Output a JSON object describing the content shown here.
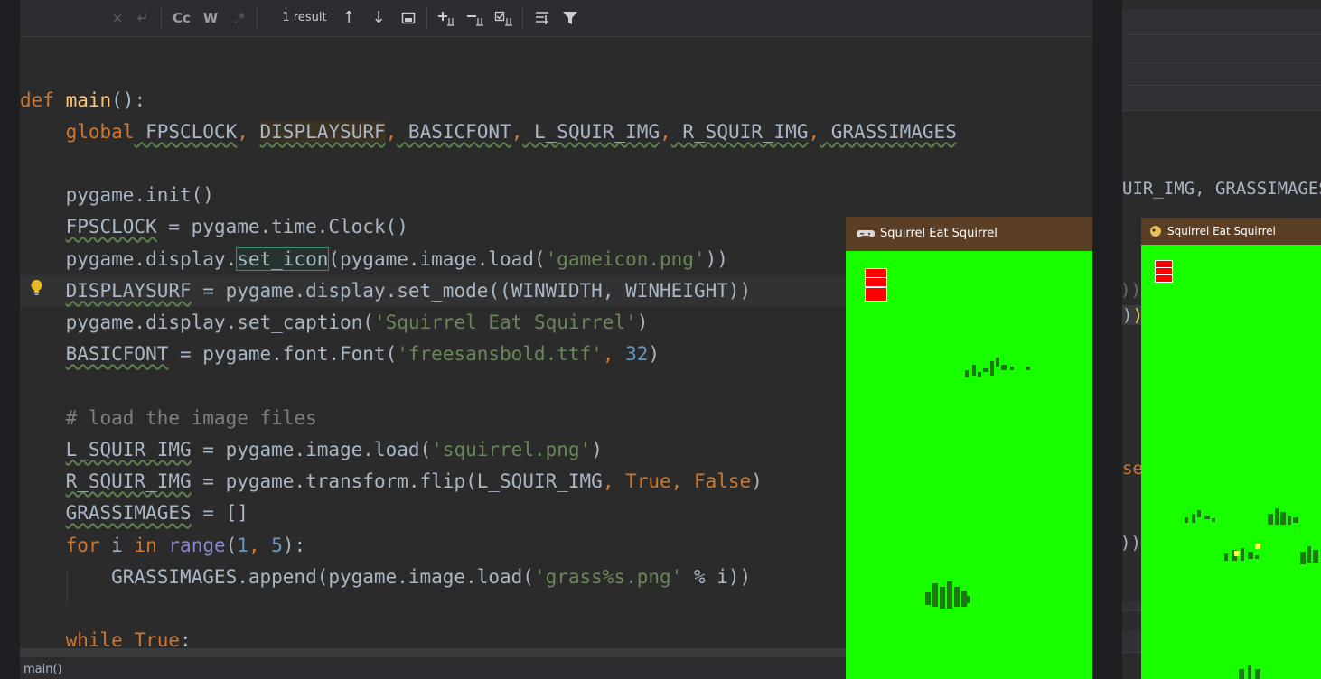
{
  "find_toolbar": {
    "close_icon": "×",
    "replace_icon": "↵",
    "match_case": "Cc",
    "words": "W",
    "regex": ".*",
    "result_count": "1 result",
    "prev_icon": "↑",
    "next_icon": "↓",
    "open_in_window_icon": "window-icon",
    "add_cursor_icon": "add-selection-icon",
    "remove_cursor_icon": "remove-selection-icon",
    "select_all_icon": "select-all-icon",
    "filter_options_icon": "filter-options-icon",
    "filter_icon": "filter-icon"
  },
  "editor": {
    "lines": {
      "l01": {
        "def": "def ",
        "name": "main",
        "rest": "():"
      },
      "l02": {
        "indent": "    ",
        "kw": "global",
        "a": " FPSCLOCK",
        "c1": ",",
        "b": "DISPLAYSURF",
        "c2": ",",
        "c": " BASICFONT",
        "c3": ",",
        "d": " L_SQUIR_IMG",
        "c4": ",",
        "e": " R_SQUIR_IMG",
        "c5": ",",
        "f": " GRASSIMAGES"
      },
      "l03": {
        "text": "    pygame.init()"
      },
      "l04": {
        "a": "    ",
        "w": "FPSCLOCK",
        "b": " = pygame.time.Clock()"
      },
      "l05": {
        "a": "    pygame.display.",
        "sel": "set_icon",
        "b": "(pygame.image.load(",
        "s": "'gameicon.png'",
        "c": "))"
      },
      "l06": {
        "a": "    ",
        "w": "DISPLAYSURF",
        "b": " = pygame.display.set_mode((WINWIDTH, WINHEIGHT))"
      },
      "l07": {
        "a": "    pygame.display.set_caption(",
        "s": "'Squirrel Eat Squirrel'",
        "b": ")"
      },
      "l08": {
        "a": "    ",
        "w": "BASICFONT",
        "b": " = pygame.font.Font(",
        "s": "'freesansbold.ttf'",
        "c": ", ",
        "n": "32",
        "d": ")"
      },
      "l09": {
        "comment": "    # load the image files"
      },
      "l10": {
        "a": "    ",
        "w": "L_SQUIR_IMG",
        "b": " = pygame.image.load(",
        "s": "'squirrel.png'",
        "c": ")"
      },
      "l11": {
        "a": "    ",
        "w": "R_SQUIR_IMG",
        "b": " = pygame.transform.flip(L_SQUIR_IMG",
        "k1": ", True, False",
        "c": ")"
      },
      "l12": {
        "a": "    ",
        "w": "GRASSIMAGES",
        "b": " = []"
      },
      "l13": {
        "a": "    ",
        "k1": "for",
        "b": " i ",
        "k2": "in",
        "c": " ",
        "bi": "range",
        "d": "(",
        "n1": "1",
        "e": ", ",
        "n2": "5",
        "f": "):"
      },
      "l14": {
        "a": "        GRASSIMAGES.append(pygame.image.load(",
        "s": "'grass%s.png'",
        "b": " % i))"
      },
      "l15": {
        "a": "    ",
        "k1": "while",
        "b": " ",
        "k2": "True",
        "c": ":"
      }
    },
    "intention_bulb_icon": "lightbulb-icon"
  },
  "status_bar": {
    "breadcrumb": "main()"
  },
  "background_editor": {
    "frag_1": "UIR_IMG, GRASSIMAGES",
    "frag_2": "))",
    "frag_3": ")",
    "frag_4": "se",
    "frag_5": "))"
  },
  "game_window_main": {
    "title": "Squirrel Eat Squirrel",
    "icon": "gamepad-icon",
    "health_bars": 3
  },
  "game_window_second": {
    "title": "Squirrel Eat Squirrel",
    "icon": "squirrel-icon",
    "health_bars": 3
  },
  "colors": {
    "grass": "#18ff00",
    "health": "#ff0000",
    "title_bar": "#5a3e25"
  }
}
